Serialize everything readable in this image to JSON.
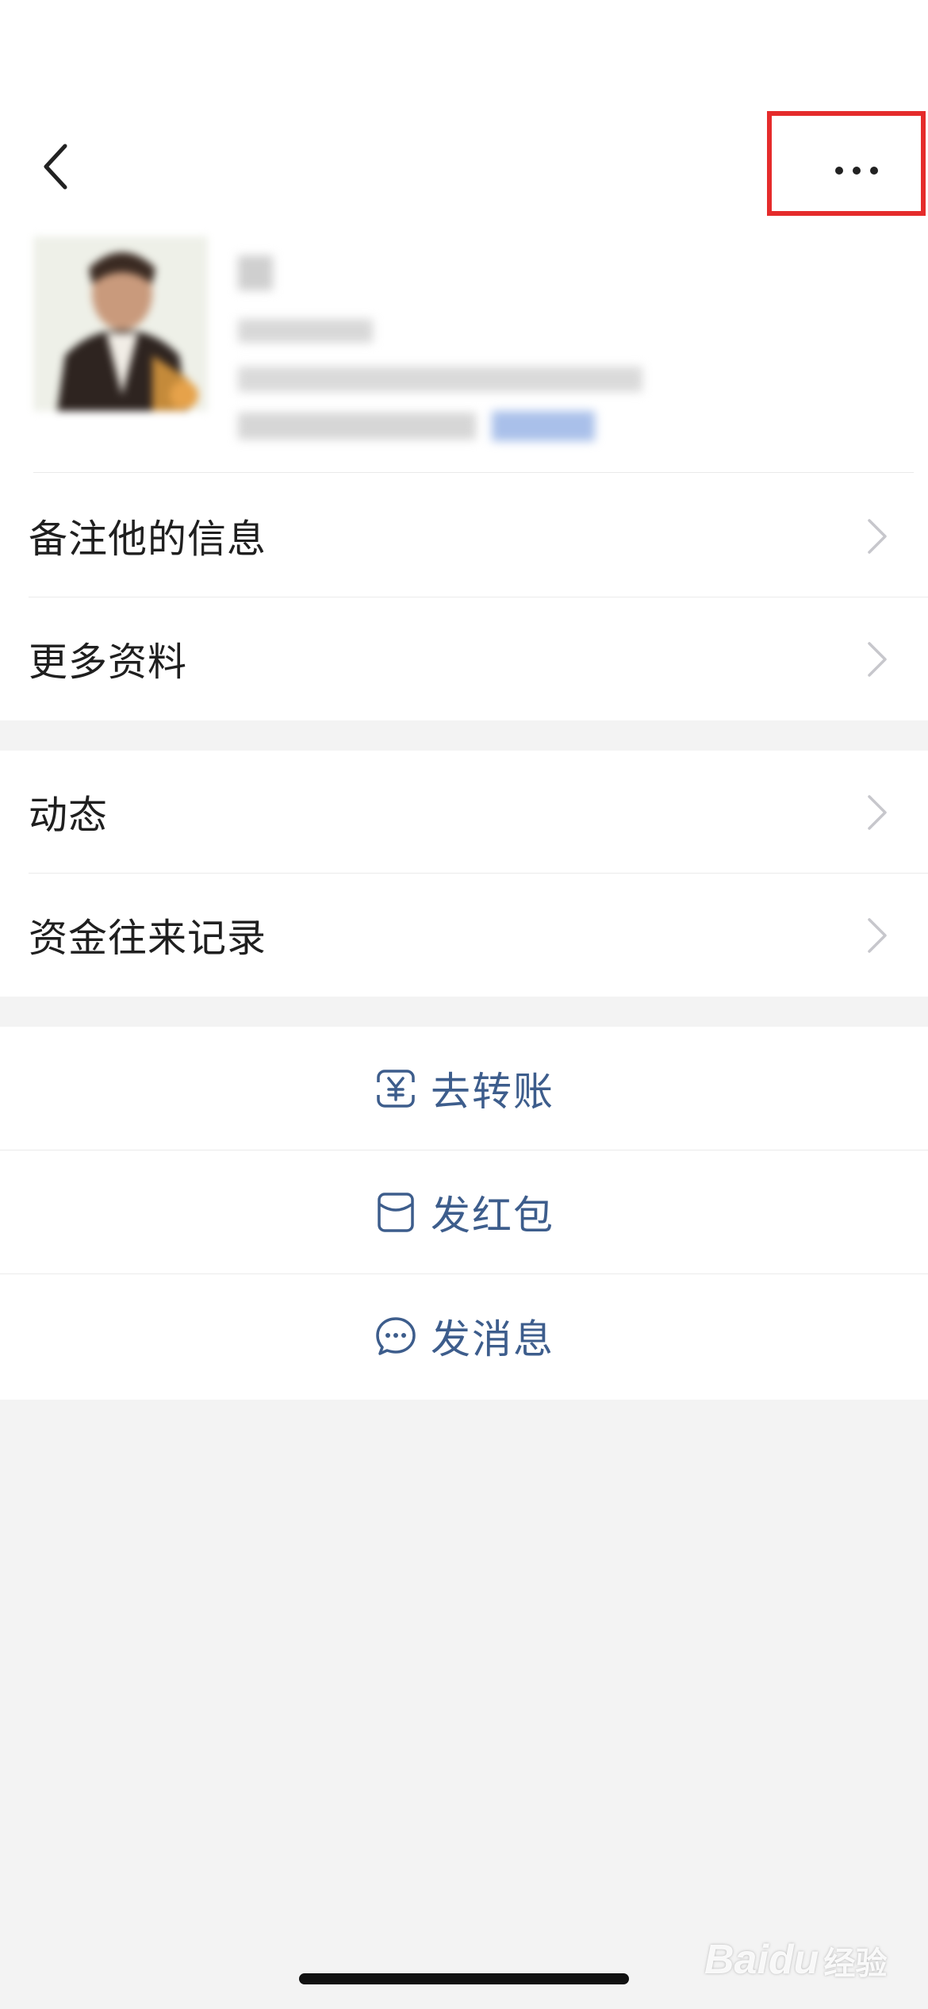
{
  "nav": {
    "back_icon": "chevron-left-icon",
    "more_icon": "more-dots-icon",
    "highlight_color": "#e52b2b"
  },
  "profile": {
    "avatar_icon": "user-avatar",
    "details_blurred": true,
    "link_color": "#a9c0ea"
  },
  "info_rows": [
    {
      "label": "备注他的信息"
    },
    {
      "label": "更多资料"
    }
  ],
  "activity_rows": [
    {
      "label": "动态"
    },
    {
      "label": "资金往来记录"
    }
  ],
  "actions": [
    {
      "label": "去转账",
      "icon": "transfer-yuan-icon"
    },
    {
      "label": "发红包",
      "icon": "red-packet-icon"
    },
    {
      "label": "发消息",
      "icon": "chat-bubble-icon"
    }
  ],
  "watermark": {
    "brand": "Baidu",
    "sub": "经验"
  },
  "colors": {
    "accent": "#3d5d8c",
    "background": "#f3f3f3",
    "card": "#ffffff",
    "chevron": "#c7c7cc"
  }
}
